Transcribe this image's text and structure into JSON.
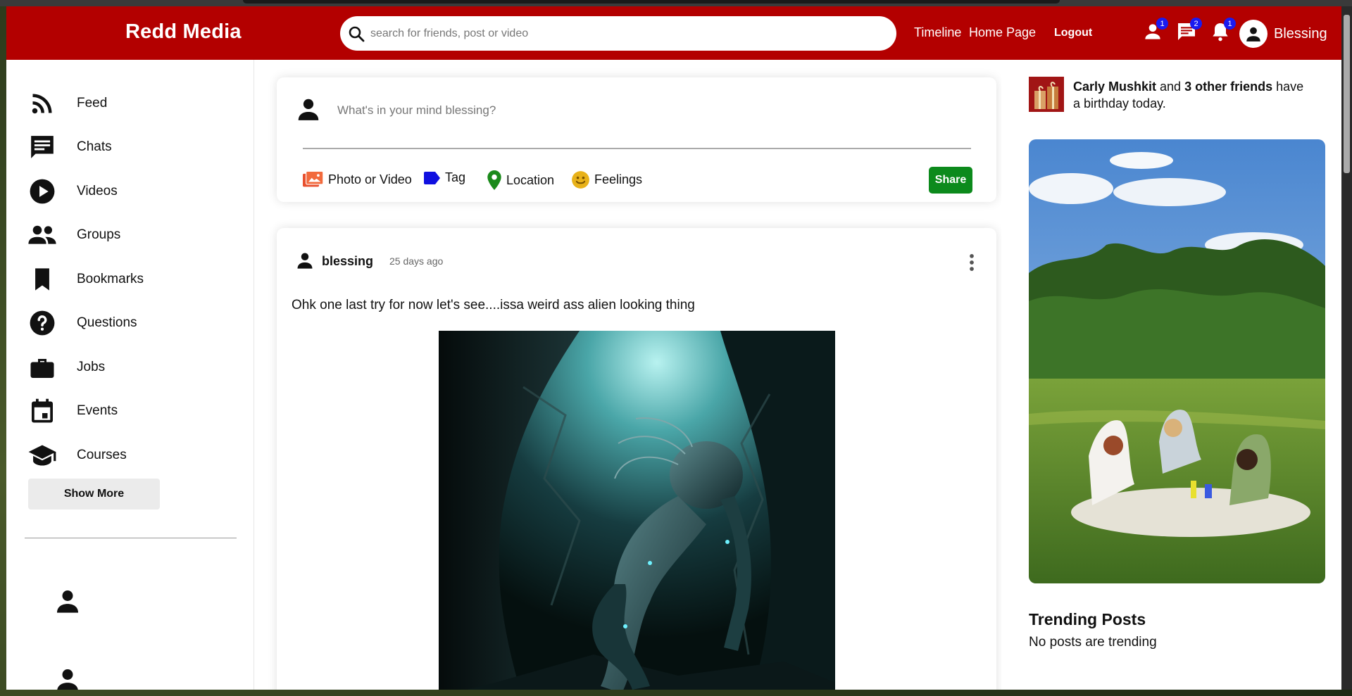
{
  "header": {
    "logo": "Redd Media",
    "search_placeholder": "search for friends, post or video",
    "links": {
      "timeline": "Timeline",
      "home": "Home Page",
      "logout": "Logout"
    },
    "badges": {
      "friends": "1",
      "messages": "2",
      "notifications": "1"
    },
    "username": "Blessing",
    "brand_color": "#b30000"
  },
  "sidebar": {
    "items": [
      {
        "label": "Feed",
        "icon": "rss-icon"
      },
      {
        "label": "Chats",
        "icon": "chat-icon"
      },
      {
        "label": "Videos",
        "icon": "play-circle-icon"
      },
      {
        "label": "Groups",
        "icon": "group-icon"
      },
      {
        "label": "Bookmarks",
        "icon": "bookmark-icon"
      },
      {
        "label": "Questions",
        "icon": "help-circle-icon"
      },
      {
        "label": "Jobs",
        "icon": "briefcase-icon"
      },
      {
        "label": "Events",
        "icon": "calendar-icon"
      },
      {
        "label": "Courses",
        "icon": "graduation-cap-icon"
      }
    ],
    "show_more": "Show More"
  },
  "share": {
    "placeholder": "What's in your mind blessing?",
    "options": {
      "photo": "Photo or Video",
      "tag": "Tag",
      "location": "Location",
      "feelings": "Feelings"
    },
    "button": "Share"
  },
  "post": {
    "user": "blessing",
    "time": "25 days ago",
    "text": "Ohk one last try for now let's see....issa weird ass alien looking thing"
  },
  "rightbar": {
    "birthday_name": "Carly Mushkit",
    "birthday_and": " and ",
    "birthday_friends": "3 other friends",
    "birthday_rest": " have a birthday today.",
    "trending_title": "Trending Posts",
    "trending_empty": "No posts are trending"
  }
}
